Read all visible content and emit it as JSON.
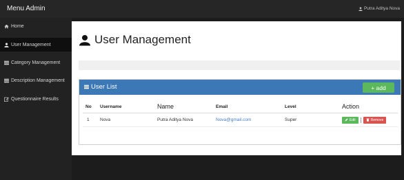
{
  "topbar": {
    "brand": "Menu Admin",
    "user_icon": "user-icon",
    "user_label": "Putra Aditya Nova"
  },
  "sidebar": {
    "items": [
      {
        "label": "Home",
        "icon": "home-icon"
      },
      {
        "label": "User Management",
        "icon": "user-icon",
        "active": true
      },
      {
        "label": "Category Management",
        "icon": "list-icon"
      },
      {
        "label": "Description Management",
        "icon": "list-icon"
      },
      {
        "label": "Questionnaire Results",
        "icon": "edit-icon"
      }
    ]
  },
  "page": {
    "title": "User Management",
    "title_icon": "user-icon"
  },
  "panel": {
    "title": "User List",
    "title_icon": "list-icon",
    "add_label": "+  add"
  },
  "table": {
    "headers": [
      "No",
      "Username",
      "Name",
      "Email",
      "Level",
      "Action"
    ],
    "rows": [
      {
        "no": "1",
        "username": "Nova",
        "name": "Putra Aditya Nova",
        "email": "Nova@gmail.com",
        "level": "Super",
        "edit_label": "Edit",
        "remove_label": "Remove"
      }
    ]
  },
  "colors": {
    "panel_header": "#3c78b5",
    "add_button": "#5cb85c",
    "remove_button": "#d9534f",
    "link": "#4a7bc1"
  }
}
